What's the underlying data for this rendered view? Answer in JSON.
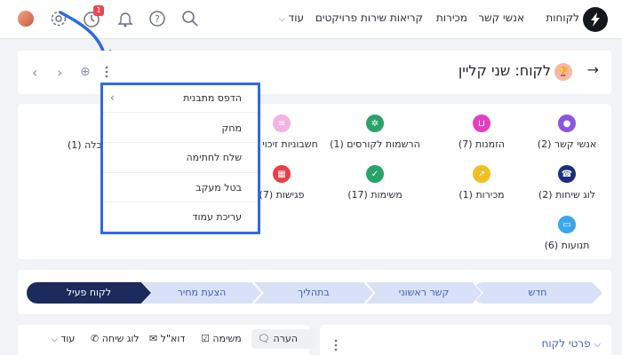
{
  "topbar": {
    "nav": [
      "לקוחות",
      "אנשי קשר",
      "מכירות",
      "קריאות שירות",
      "פרויקטים",
      "עוד"
    ],
    "badge_count": "1"
  },
  "header": {
    "title": "לקוח: שני קליין"
  },
  "menu": {
    "items": [
      "הדפס מתבנית",
      "מחק",
      "שלח לחתימה",
      "בטל מעקב",
      "עריכת עמוד"
    ]
  },
  "related": [
    {
      "label": "אנשי קשר (2)",
      "icon": "person-icon",
      "color": "#8a55e0"
    },
    {
      "label": "הזמנות (7)",
      "icon": "cart-icon",
      "color": "#e040c0"
    },
    {
      "label": "הרשמות לקורסים (1)",
      "icon": "gear-icon",
      "color": "#2aa36b"
    },
    {
      "label": "חשבוניות זיכוי (1)",
      "icon": "invoice-icon",
      "color": "#f3b3e0"
    },
    {
      "label": "לוג שיחות (2)",
      "icon": "phone-icon",
      "color": "#1c2f7a"
    },
    {
      "label": "מכירות (1)",
      "icon": "chart-icon",
      "color": "#f0c020"
    },
    {
      "label": "משימות (17)",
      "icon": "check-icon",
      "color": "#2aa36b"
    },
    {
      "label": "פגישות (7)",
      "icon": "calendar-icon",
      "color": "#ea3f4a"
    },
    {
      "label": "תנועות (6)",
      "icon": "card-icon",
      "color": "#3aa7e8"
    },
    {
      "label": "בלה (1)",
      "icon": "",
      "color": ""
    }
  ],
  "stages": [
    "חדש",
    "קשר ראשוני",
    "בתהליך",
    "הצעת מחיר",
    "לקוח פעיל"
  ],
  "activity": {
    "note": "הערה",
    "task": "משימה",
    "email": "דוא\"ל",
    "call_log": "לוג שיחה",
    "more": "עוד"
  },
  "details": {
    "label": "פרטי לקוח"
  }
}
